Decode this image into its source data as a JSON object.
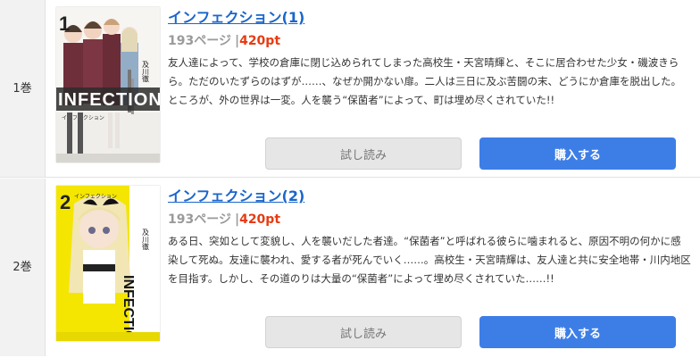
{
  "volumes": [
    {
      "volume_label": "1巻",
      "title": "インフェクション(1)",
      "pages": "193ページ",
      "separator": "|",
      "price": "420pt",
      "description": "友人達によって、学校の倉庫に閉じ込められてしまった高校生・天宮晴輝と、そこに居合わせた少女・磯波きらら。ただのいたずらのはずが……、なぜか開かない扉。二人は三日に及ぶ苦闘の末、どうにか倉庫を脱出した。ところが、外の世界は一変。人を襲う“保菌者”によって、町は埋め尽くされていた!!",
      "trial_label": "試し読み",
      "buy_label": "購入する",
      "cover": {
        "number": "1",
        "author": "及川徹",
        "series_title": "INFECTION",
        "series_title_jp": "インフェクション"
      }
    },
    {
      "volume_label": "2巻",
      "title": "インフェクション(2)",
      "pages": "193ページ",
      "separator": "|",
      "price": "420pt",
      "description": "ある日、突如として変貌し、人を襲いだした者達。“保菌者”と呼ばれる彼らに噛まれると、原因不明の何かに感染して死ぬ。友達に襲われ、愛する者が死んでいく……。高校生・天宮晴輝は、友人達と共に安全地帯・川内地区を目指す。しかし、その道のりは大量の“保菌者”によって埋め尽くされていた……!!",
      "trial_label": "試し読み",
      "buy_label": "購入する",
      "cover": {
        "number": "2",
        "author": "及川徹",
        "series_title": "INFECTION",
        "series_title_jp": "インフェクション"
      }
    }
  ]
}
